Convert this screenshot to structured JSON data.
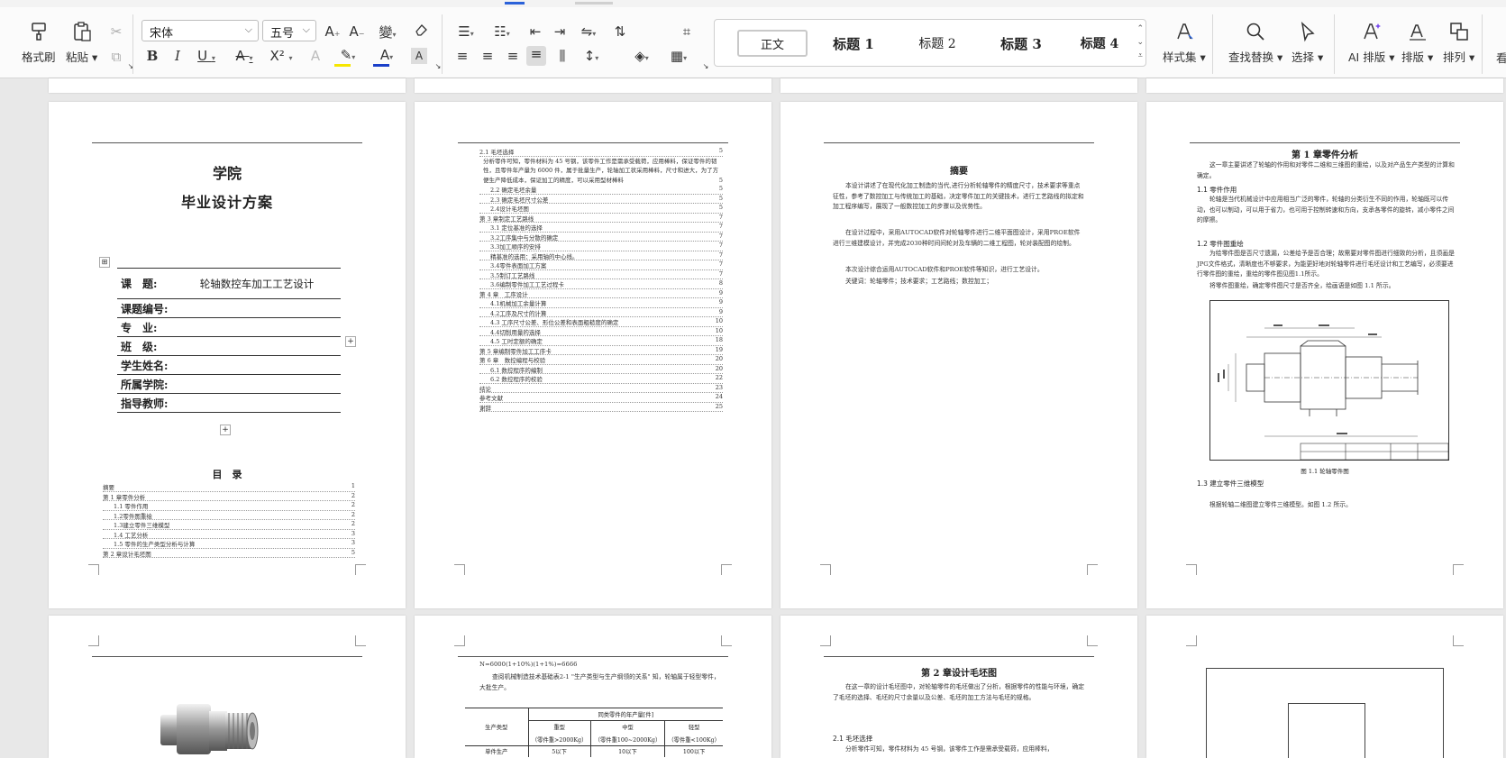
{
  "toolbar": {
    "format_painter": "格式刷",
    "paste": "粘贴",
    "font_name": "宋体",
    "font_size": "五号",
    "styles": {
      "normal": "正文",
      "h1": "标题 1",
      "h2": "标题 2",
      "h3": "标题 3",
      "h4": "标题 4"
    },
    "style_set": "样式集",
    "find_replace": "查找替换",
    "select": "选择",
    "ai_layout": "AI 排版",
    "layout": "排版",
    "arrange": "排列",
    "cut_label": "看",
    "icons": {
      "bold": "B",
      "italic": "I",
      "underline": "U",
      "strike": "A",
      "superscript": "X²",
      "grow": "A⁺",
      "shrink": "A⁻",
      "pinyin": "变",
      "erase": "◇"
    }
  },
  "cover": {
    "school": "学院",
    "title": "毕业设计方案",
    "rows": [
      {
        "label": "课　题:",
        "value": "轮轴数控车加工工艺设计"
      },
      {
        "label": "课题编号:",
        "value": ""
      },
      {
        "label": "专　业:",
        "value": ""
      },
      {
        "label": "班　级:",
        "value": ""
      },
      {
        "label": "学生姓名:",
        "value": ""
      },
      {
        "label": "所属学院:",
        "value": ""
      },
      {
        "label": "指导教师:",
        "value": ""
      }
    ],
    "toc_title": "目　录",
    "toc": [
      {
        "t": "摘要",
        "p": "1"
      },
      {
        "t": "第 1 章零件分析",
        "p": "2"
      },
      {
        "t": "1.1 零件作用",
        "p": "2"
      },
      {
        "t": "1.2零件图重绘",
        "p": "2"
      },
      {
        "t": "1.3建立零件三维模型",
        "p": "2"
      },
      {
        "t": "1.4 工艺分析",
        "p": "3"
      },
      {
        "t": "1.5 零件的生产类型分析与计算",
        "p": "3"
      },
      {
        "t": "第 2 章设计毛坯图",
        "p": "5"
      }
    ]
  },
  "page2": {
    "toc_top": {
      "t": "2.1 毛坯选择",
      "p": "5"
    },
    "toc_para": "分析零件可知，零件材料为 45 号钢，该零件工作是需承受载荷，应用棒料，保证零件的韧性，且零件年产量为 6000 件，属于批量生产，轮轴加工状采用棒料，尺寸和进大，为了方便生产降低成本，保证加工的精度，可以采用型材棒料",
    "toc_para_p": "5",
    "toc": [
      {
        "t": "2.2 确定毛坯余量",
        "p": "5"
      },
      {
        "t": "2.3 确定毛坯尺寸公差",
        "p": "5"
      },
      {
        "t": "2.4设计毛坯图",
        "p": "5"
      },
      {
        "t": "第 3 章制定工艺路线",
        "p": "7"
      },
      {
        "t": "3.1 定位基准的选择",
        "p": "7"
      },
      {
        "t": "3.2工序集中与分散的确定",
        "p": "7"
      },
      {
        "t": "3.3加工顺序的安排",
        "p": "7"
      },
      {
        "t": "精基准的选用：采用轴的中心线。",
        "p": "7"
      },
      {
        "t": "3.4零件表面加工方案",
        "p": "7"
      },
      {
        "t": "3.5制订工艺路线",
        "p": "7"
      },
      {
        "t": "3.6编制零件加工工艺过程卡",
        "p": "8"
      },
      {
        "t": "第 4 章　工序设计",
        "p": "9"
      },
      {
        "t": "4.1机械加工余量计算",
        "p": "9"
      },
      {
        "t": "4.2工序及尺寸的计算",
        "p": "9"
      },
      {
        "t": "4.3 工序尺寸公差、形位公差和表面粗糙度的确定",
        "p": "10"
      },
      {
        "t": "4.4切削用量的选择",
        "p": "10"
      },
      {
        "t": "4.5 工时定额的确定",
        "p": "18"
      },
      {
        "t": "第 5 章编制零件加工工序卡",
        "p": "19"
      },
      {
        "t": "第 6 章　数控编程与校验",
        "p": "20"
      },
      {
        "t": "6.1 数控程序的编制",
        "p": "20"
      },
      {
        "t": "6.2 数控程序的校验",
        "p": "22"
      },
      {
        "t": "结论",
        "p": "23"
      },
      {
        "t": "参考文献",
        "p": "24"
      },
      {
        "t": "谢辞",
        "p": "25"
      }
    ]
  },
  "page3": {
    "title": "摘要",
    "p1": "本设计讲述了在现代化加工制造的当代,进行分析轮轴零件的精度尺寸，技术要求等重点征性，参考了数控加工与传统加工的基础，决定零件加工的关键技术，进行工艺路线的拟定和加工程序编写，展现了一般数控加工的步骤以及优势性。",
    "p2": "在设计过程中，采用AUTOCAD软件对轮轴零件进行二维平面图设计，采用PROE软件进行三维建模设计，并完成2030种时间间轮对及车辆的二维工程图，轮对装配图的绘制。",
    "p3": "本次设计综合运用AUTOCAD软件和PROE软件等知识，进行工艺设计。",
    "kw": "关键词：轮轴零件；技术要求；工艺路线；数控加工；"
  },
  "page4": {
    "title": "第 1 章零件分析",
    "intro": "这一章主要讲述了轮轴的作用和对零件二维和三维图的重绘，以及对产品生产类型的计算和确定。",
    "s11": "1.1  零件作用",
    "p11": "轮轴是当代机械设计中应用相当广泛的零件，轮轴的分类衍生不同的作用，轮轴既可以传动，也可以制动，可以用于省力，也可用于控制转速和方向，支承各零件的旋转，减小零件之间的摩擦。",
    "s12": "1.2 零件图重绘",
    "p12": "为绘零件图是否尺寸遗漏，公差给予是否合理；故需要对零件图进行细致的分析，且须画是JPG文件格式，清晰度也不够要求，为能更好地对轮轴零件进行毛坯设计和工艺编写，必须要进行零件图的重绘，重绘的零件图见图1.1所示。",
    "p12b": "将零件图重绘，确定零件图尺寸是否齐全，绘画语是如图 1.1 所示。",
    "fig": "图 1.1  轮轴零件图",
    "s13": "1.3 建立零件三维模型",
    "p13": "根据轮轴二维图建立零件三维模型。如图 1.2 所示。"
  },
  "page6": {
    "line1": "N=6000(1+10%)(1+1%)=6666",
    "line2": "查阅机械制造技术基础表2-1 \"生产类型与生产纲领的关系\" 知，轮轴属于轻型零件，大批生产。",
    "table_head": "同类零件的年产量[件]",
    "col0": "生产类型",
    "cols": [
      "重型",
      "中型",
      "轻型"
    ],
    "sub": [
      "（零件重>2000Kg）",
      "（零件重100~2000Kg）",
      "（零件重<100Kg）"
    ],
    "row1": [
      "单件生产",
      "5以下",
      "10以下",
      "100以下"
    ]
  },
  "page7": {
    "title": "第 2 章设计毛坯图",
    "p1": "在这一章的设计毛坯图中，对轮轴零件的毛坯做出了分析，根据零件的性能与环境，确定了毛坯的选择、毛坯的尺寸余量以及公差、毛坯的加工方法与毛坯的规格。",
    "s21": "2.1  毛坯选择",
    "p21": "分析零件可知，零件材料为 45 号钢，该零件工作是需承受载荷，应用棒料，"
  }
}
